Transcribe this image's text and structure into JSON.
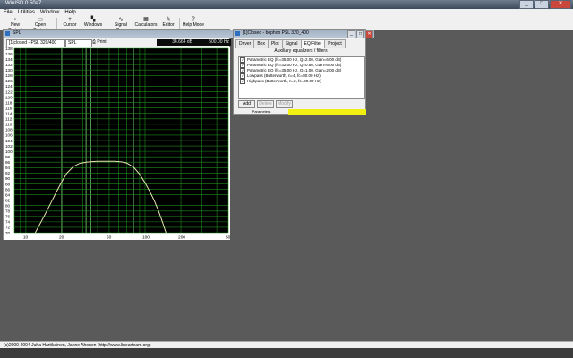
{
  "app": {
    "title": "WinISD 0.50a7",
    "minimize": "_",
    "maximize": "□",
    "close": "✕"
  },
  "menu": [
    "File",
    "Utilities",
    "Window",
    "Help"
  ],
  "toolbar": [
    {
      "label": "New Project",
      "icon": "new-project-icon"
    },
    {
      "label": "Open Project",
      "icon": "open-project-icon"
    },
    {
      "label": "Cursor",
      "icon": "cursor-icon"
    },
    {
      "label": "Windows",
      "icon": "windows-icon"
    },
    {
      "label": "Signal Gen.",
      "icon": "signal-gen-icon"
    },
    {
      "label": "Calculators",
      "icon": "calculators-icon"
    },
    {
      "label": "Editor",
      "icon": "editor-icon"
    },
    {
      "label": "Help Mode",
      "icon": "help-mode-icon"
    }
  ],
  "spl_window": {
    "title": "SPL",
    "project_select": "[1]closed - PSL 320/400",
    "graph_select": "SPL",
    "print_label": "Print",
    "readout_db": "34.664 dB",
    "readout_hz": "500.00 Hz"
  },
  "chart_data": {
    "type": "line",
    "title": "",
    "xlabel": "",
    "ylabel": "",
    "x_scale": "log",
    "xlim": [
      8,
      500
    ],
    "ylim": [
      70,
      138
    ],
    "x_ticks": [
      "10",
      "20",
      "50",
      "100",
      "200",
      "500"
    ],
    "y_ticks": [
      "138",
      "136",
      "134",
      "132",
      "130",
      "128",
      "126",
      "124",
      "122",
      "120",
      "118",
      "116",
      "114",
      "112",
      "110",
      "108",
      "106",
      "104",
      "102",
      "100",
      "98",
      "96",
      "94",
      "92",
      "90",
      "88",
      "86",
      "84",
      "82",
      "80",
      "78",
      "76",
      "74",
      "72",
      "70"
    ],
    "grid": true,
    "background": "#000000",
    "grid_color": "#1f8a1f",
    "highlight_grid_color": "#7cd07c",
    "line_color": "#e8e6b0",
    "series": [
      {
        "x": [
          12,
          14,
          16,
          18,
          20,
          22,
          25,
          28,
          32,
          36,
          40,
          45,
          50,
          56,
          63,
          70,
          80,
          90,
          100,
          110,
          120,
          130,
          140,
          150
        ],
        "y": [
          70,
          75.5,
          80.5,
          85,
          88.8,
          91.9,
          94.4,
          95.5,
          96.0,
          96.2,
          96.3,
          96.3,
          96.3,
          96.3,
          96.1,
          95.7,
          94.2,
          91.6,
          88.4,
          85.1,
          81.7,
          78.0,
          74.0,
          70
        ]
      }
    ]
  },
  "filter_window": {
    "title": "[1]Closed - bophon PSL 320_400",
    "tabs": [
      "Driver",
      "Box",
      "Plot",
      "Signal",
      "EQ/Filter",
      "Project"
    ],
    "active_tab": "EQ/Filter",
    "subheading": "Auxiliary equalizers / filters",
    "filters": [
      "Parametric EQ (fc=35.00 Hz, Q=2.00, Gain=6.00 dB)",
      "Parametric EQ (fc=32.00 Hz, Q=0.50, Gain=6.00 dB)",
      "Parametric EQ (fc=35.00 Hz, Q=1.00, Gain=2.00 dB)",
      "Lowpass (Butterworth, n=4, fc=80.00 Hz)",
      "Highpass (Butterworth, n=2, fc=20.00 Hz)"
    ],
    "add_label": "Add",
    "delete_label": "Delete",
    "modify_label": "Modify",
    "status_label": "Parameters"
  },
  "status_bar": {
    "text": "(c)2000-2004 Juha Hartikainen, Janne Ahonen (http://www.linearteam.org)"
  }
}
